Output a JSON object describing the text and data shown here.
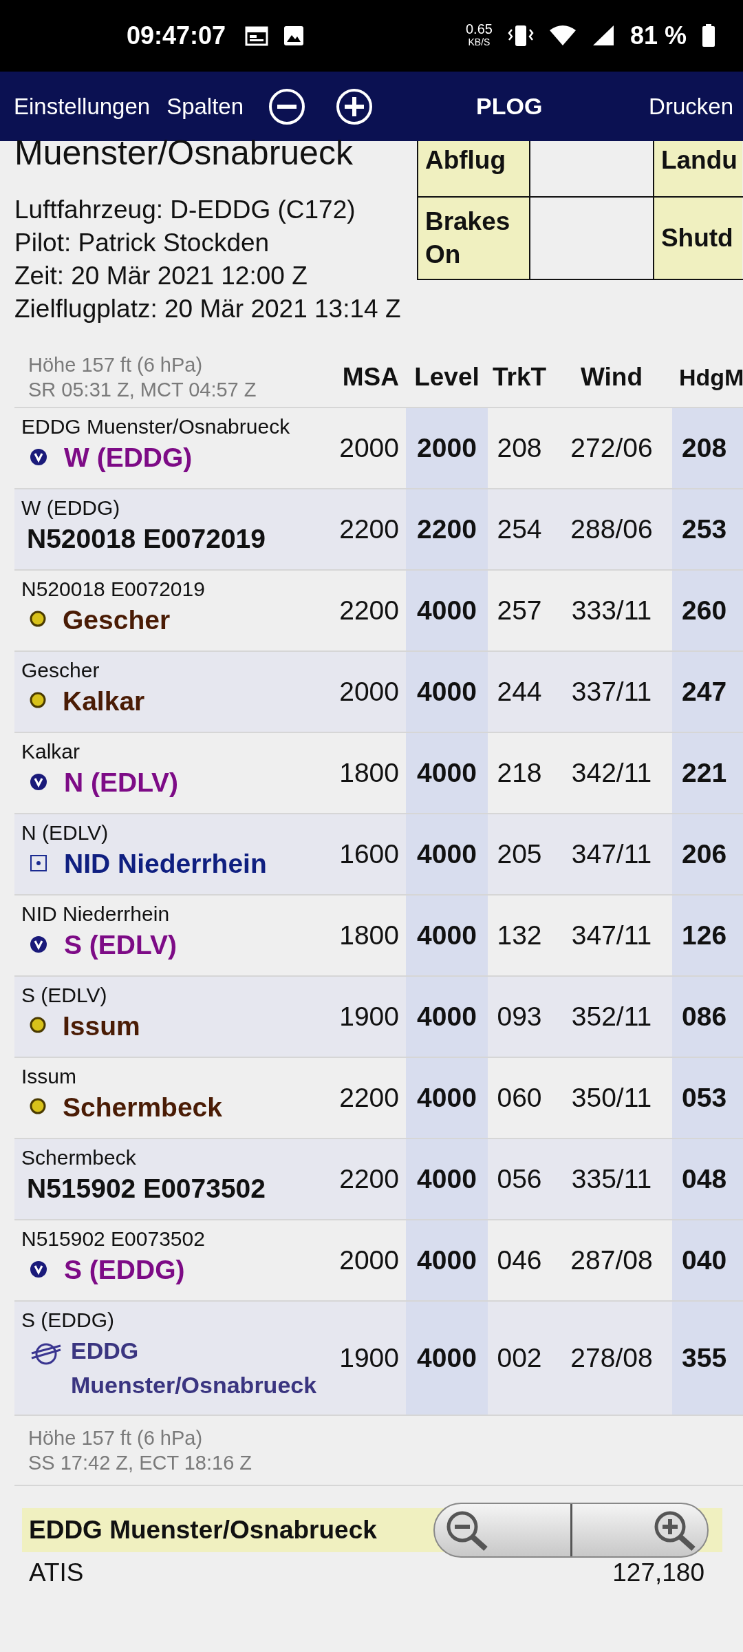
{
  "status_bar": {
    "time": "09:47:07",
    "speed": "0.65",
    "speed_unit": "KB/S",
    "battery": "81 %"
  },
  "toolbar": {
    "items": [
      "Einstellungen",
      "Spalten"
    ],
    "title": "PLOG",
    "print": "Drucken"
  },
  "header": {
    "title": "Muenster/Osnabrueck",
    "info": [
      "Luftfahrzeug: D-EDDG (C172)",
      "Pilot: Patrick Stockden",
      "Zeit: 20 Mär 2021 12:00 Z",
      "Zielflugplatz: 20 Mär 2021 13:14 Z"
    ],
    "times_table": [
      {
        "event": "Abflug",
        "next_event": "Landu"
      },
      {
        "event": "Brakes On",
        "next_event": "Shutd"
      }
    ]
  },
  "table": {
    "departure_info": [
      "Höhe 157 ft (6 hPa)",
      "SR 05:31 Z, MCT 04:57 Z"
    ],
    "columns": [
      "MSA",
      "Level",
      "TrkT",
      "Wind",
      "HdgM"
    ],
    "rows": [
      {
        "from": "EDDG Muenster/Osnabrueck",
        "name": "W (EDDG)",
        "kind": "vor",
        "msa": "2000",
        "level": "2000",
        "trk": "208",
        "wind": "272/06",
        "hdg": "208"
      },
      {
        "from": "W (EDDG)",
        "name": "N520018 E0072019",
        "kind": "userpoint",
        "msa": "2200",
        "level": "2200",
        "trk": "254",
        "wind": "288/06",
        "hdg": "253"
      },
      {
        "from": "N520018 E0072019",
        "name": "Gescher",
        "kind": "ndb",
        "msa": "2200",
        "level": "4000",
        "trk": "257",
        "wind": "333/11",
        "hdg": "260"
      },
      {
        "from": "Gescher",
        "name": "Kalkar",
        "kind": "ndb",
        "msa": "2000",
        "level": "4000",
        "trk": "244",
        "wind": "337/11",
        "hdg": "247"
      },
      {
        "from": "Kalkar",
        "name": "N (EDLV)",
        "kind": "vor",
        "msa": "1800",
        "level": "4000",
        "trk": "218",
        "wind": "342/11",
        "hdg": "221"
      },
      {
        "from": "N (EDLV)",
        "name": "NID Niederrhein",
        "kind": "dme",
        "msa": "1600",
        "level": "4000",
        "trk": "205",
        "wind": "347/11",
        "hdg": "206"
      },
      {
        "from": "NID Niederrhein",
        "name": "S (EDLV)",
        "kind": "vor",
        "msa": "1800",
        "level": "4000",
        "trk": "132",
        "wind": "347/11",
        "hdg": "126"
      },
      {
        "from": "S (EDLV)",
        "name": "Issum",
        "kind": "ndb",
        "msa": "1900",
        "level": "4000",
        "trk": "093",
        "wind": "352/11",
        "hdg": "086"
      },
      {
        "from": "Issum",
        "name": "Schermbeck",
        "kind": "ndb",
        "msa": "2200",
        "level": "4000",
        "trk": "060",
        "wind": "350/11",
        "hdg": "053"
      },
      {
        "from": "Schermbeck",
        "name": "N515902 E0073502",
        "kind": "userpoint",
        "msa": "2200",
        "level": "4000",
        "trk": "056",
        "wind": "335/11",
        "hdg": "048"
      },
      {
        "from": "N515902 E0073502",
        "name": "S (EDDG)",
        "kind": "vor",
        "msa": "2000",
        "level": "4000",
        "trk": "046",
        "wind": "287/08",
        "hdg": "040"
      },
      {
        "from": "S (EDDG)",
        "name": "EDDG Muenster/Osnabrueck",
        "kind": "airport",
        "msa": "1900",
        "level": "4000",
        "trk": "002",
        "wind": "278/08",
        "hdg": "355"
      }
    ],
    "arrival_info": [
      "Höhe 157 ft (6 hPa)",
      "SS 17:42 Z, ECT 18:16 Z"
    ]
  },
  "airport": {
    "title": "EDDG Muenster/Osnabrueck",
    "frequencies": [
      {
        "label": "ATIS",
        "value": "127,180"
      }
    ]
  }
}
